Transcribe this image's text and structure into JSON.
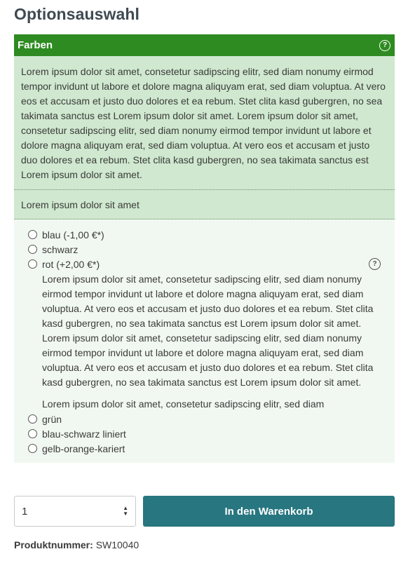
{
  "page": {
    "title": "Optionsauswahl"
  },
  "group": {
    "title": "Farben",
    "description": "Lorem ipsum dolor sit amet, consetetur sadipscing elitr, sed diam nonumy eirmod tempor invidunt ut labore et dolore magna aliquyam erat, sed diam voluptua. At vero eos et accusam et justo duo dolores et ea rebum. Stet clita kasd gubergren, no sea takimata sanctus est Lorem ipsum dolor sit amet. Lorem ipsum dolor sit amet, consetetur sadipscing elitr, sed diam nonumy eirmod tempor invidunt ut labore et dolore magna aliquyam erat, sed diam voluptua. At vero eos et accusam et justo duo dolores et ea rebum. Stet clita kasd gubergren, no sea takimata sanctus est Lorem ipsum dolor sit amet.",
    "subdescription": "Lorem ipsum dolor sit amet",
    "options": [
      {
        "label": "blau (-1,00 €*)"
      },
      {
        "label": "schwarz"
      },
      {
        "label": "rot (+2,00 €*)",
        "description": "Lorem ipsum dolor sit amet, consetetur sadipscing elitr, sed diam nonumy eirmod tempor invidunt ut labore et dolore magna aliquyam erat, sed diam voluptua. At vero eos et accusam et justo duo dolores et ea rebum. Stet clita kasd gubergren, no sea takimata sanctus est Lorem ipsum dolor sit amet. Lorem ipsum dolor sit amet, consetetur sadipscing elitr, sed diam nonumy eirmod tempor invidunt ut labore et dolore magna aliquyam erat, sed diam voluptua. At vero eos et accusam et justo duo dolores et ea rebum. Stet clita kasd gubergren, no sea takimata sanctus est Lorem ipsum dolor sit amet.",
        "subdescription": "Lorem ipsum dolor sit amet, consetetur sadipscing elitr, sed diam"
      },
      {
        "label": "grün"
      },
      {
        "label": "blau-schwarz liniert"
      },
      {
        "label": "gelb-orange-kariert"
      }
    ],
    "help_icon_symbol": "?"
  },
  "buy": {
    "quantity": "1",
    "cart_button_label": "In den Warenkorb"
  },
  "product": {
    "number_label": "Produktnummer:",
    "number_value": "SW10040"
  },
  "colors": {
    "header_green": "#2e8b21",
    "description_bg": "#cfe8cf",
    "options_bg": "#f1f8f1",
    "button_teal": "#277680"
  }
}
